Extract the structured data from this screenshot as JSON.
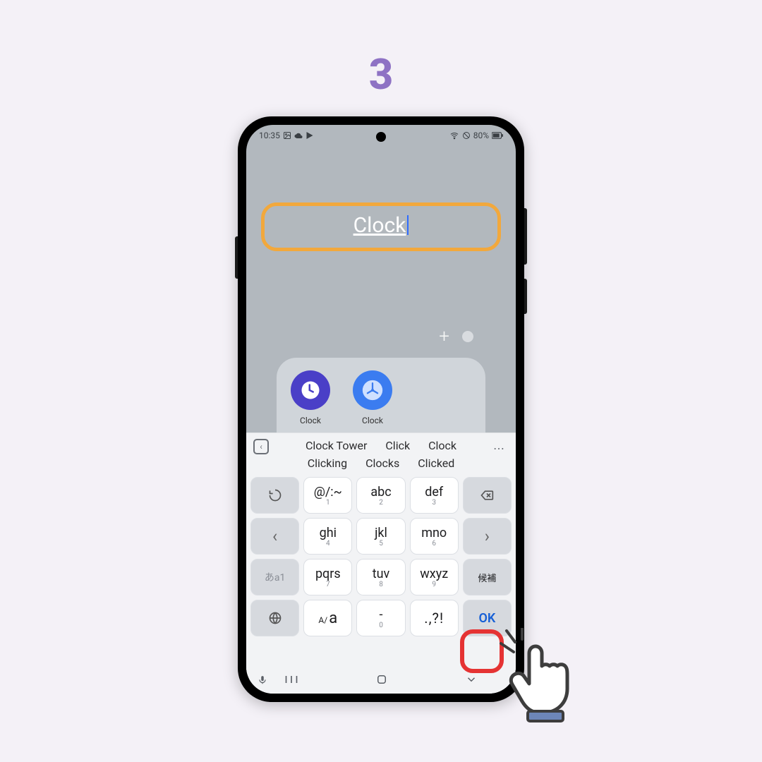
{
  "step_number": "3",
  "status": {
    "time": "10:35",
    "battery": "80%"
  },
  "folder_name_value": "Clock",
  "apps": [
    {
      "label": "Clock"
    },
    {
      "label": "Clock"
    }
  ],
  "suggestions_row1": [
    "Clock Tower",
    "Click",
    "Clock"
  ],
  "suggestions_row2": [
    "Clicking",
    "Clocks",
    "Clicked"
  ],
  "keys": {
    "r1": [
      {
        "main": "@/:~",
        "sub": "1"
      },
      {
        "main": "abc",
        "sub": "2"
      },
      {
        "main": "def",
        "sub": "3"
      }
    ],
    "r2": [
      {
        "main": "ghi",
        "sub": "4"
      },
      {
        "main": "jkl",
        "sub": "5"
      },
      {
        "main": "mno",
        "sub": "6"
      }
    ],
    "r3": [
      {
        "main": "pqrs",
        "sub": "7"
      },
      {
        "main": "tuv",
        "sub": "8"
      },
      {
        "main": "wxyz",
        "sub": "9"
      }
    ],
    "r4": [
      {
        "main": "-",
        "sub": "0"
      },
      {
        "main": ".,?!",
        "sub": ""
      }
    ],
    "kana_label": "あa1",
    "case_label_small": "A/",
    "case_label_big": "a",
    "candidate_label": "候補",
    "ok_label": "OK"
  }
}
